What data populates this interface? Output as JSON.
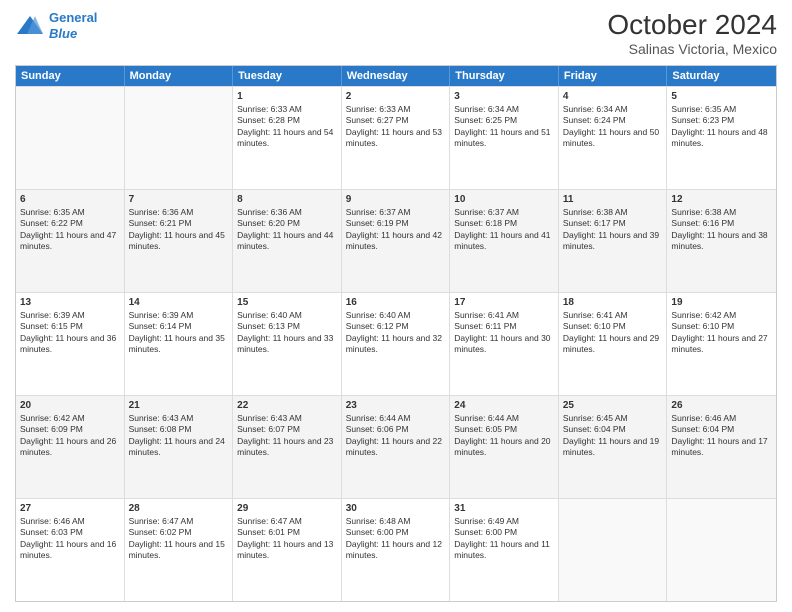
{
  "header": {
    "logo_line1": "General",
    "logo_line2": "Blue",
    "title": "October 2024",
    "subtitle": "Salinas Victoria, Mexico"
  },
  "weekdays": [
    "Sunday",
    "Monday",
    "Tuesday",
    "Wednesday",
    "Thursday",
    "Friday",
    "Saturday"
  ],
  "weeks": [
    {
      "alt": false,
      "days": [
        {
          "num": "",
          "info": ""
        },
        {
          "num": "",
          "info": ""
        },
        {
          "num": "1",
          "info": "Sunrise: 6:33 AM\nSunset: 6:28 PM\nDaylight: 11 hours and 54 minutes."
        },
        {
          "num": "2",
          "info": "Sunrise: 6:33 AM\nSunset: 6:27 PM\nDaylight: 11 hours and 53 minutes."
        },
        {
          "num": "3",
          "info": "Sunrise: 6:34 AM\nSunset: 6:25 PM\nDaylight: 11 hours and 51 minutes."
        },
        {
          "num": "4",
          "info": "Sunrise: 6:34 AM\nSunset: 6:24 PM\nDaylight: 11 hours and 50 minutes."
        },
        {
          "num": "5",
          "info": "Sunrise: 6:35 AM\nSunset: 6:23 PM\nDaylight: 11 hours and 48 minutes."
        }
      ]
    },
    {
      "alt": true,
      "days": [
        {
          "num": "6",
          "info": "Sunrise: 6:35 AM\nSunset: 6:22 PM\nDaylight: 11 hours and 47 minutes."
        },
        {
          "num": "7",
          "info": "Sunrise: 6:36 AM\nSunset: 6:21 PM\nDaylight: 11 hours and 45 minutes."
        },
        {
          "num": "8",
          "info": "Sunrise: 6:36 AM\nSunset: 6:20 PM\nDaylight: 11 hours and 44 minutes."
        },
        {
          "num": "9",
          "info": "Sunrise: 6:37 AM\nSunset: 6:19 PM\nDaylight: 11 hours and 42 minutes."
        },
        {
          "num": "10",
          "info": "Sunrise: 6:37 AM\nSunset: 6:18 PM\nDaylight: 11 hours and 41 minutes."
        },
        {
          "num": "11",
          "info": "Sunrise: 6:38 AM\nSunset: 6:17 PM\nDaylight: 11 hours and 39 minutes."
        },
        {
          "num": "12",
          "info": "Sunrise: 6:38 AM\nSunset: 6:16 PM\nDaylight: 11 hours and 38 minutes."
        }
      ]
    },
    {
      "alt": false,
      "days": [
        {
          "num": "13",
          "info": "Sunrise: 6:39 AM\nSunset: 6:15 PM\nDaylight: 11 hours and 36 minutes."
        },
        {
          "num": "14",
          "info": "Sunrise: 6:39 AM\nSunset: 6:14 PM\nDaylight: 11 hours and 35 minutes."
        },
        {
          "num": "15",
          "info": "Sunrise: 6:40 AM\nSunset: 6:13 PM\nDaylight: 11 hours and 33 minutes."
        },
        {
          "num": "16",
          "info": "Sunrise: 6:40 AM\nSunset: 6:12 PM\nDaylight: 11 hours and 32 minutes."
        },
        {
          "num": "17",
          "info": "Sunrise: 6:41 AM\nSunset: 6:11 PM\nDaylight: 11 hours and 30 minutes."
        },
        {
          "num": "18",
          "info": "Sunrise: 6:41 AM\nSunset: 6:10 PM\nDaylight: 11 hours and 29 minutes."
        },
        {
          "num": "19",
          "info": "Sunrise: 6:42 AM\nSunset: 6:10 PM\nDaylight: 11 hours and 27 minutes."
        }
      ]
    },
    {
      "alt": true,
      "days": [
        {
          "num": "20",
          "info": "Sunrise: 6:42 AM\nSunset: 6:09 PM\nDaylight: 11 hours and 26 minutes."
        },
        {
          "num": "21",
          "info": "Sunrise: 6:43 AM\nSunset: 6:08 PM\nDaylight: 11 hours and 24 minutes."
        },
        {
          "num": "22",
          "info": "Sunrise: 6:43 AM\nSunset: 6:07 PM\nDaylight: 11 hours and 23 minutes."
        },
        {
          "num": "23",
          "info": "Sunrise: 6:44 AM\nSunset: 6:06 PM\nDaylight: 11 hours and 22 minutes."
        },
        {
          "num": "24",
          "info": "Sunrise: 6:44 AM\nSunset: 6:05 PM\nDaylight: 11 hours and 20 minutes."
        },
        {
          "num": "25",
          "info": "Sunrise: 6:45 AM\nSunset: 6:04 PM\nDaylight: 11 hours and 19 minutes."
        },
        {
          "num": "26",
          "info": "Sunrise: 6:46 AM\nSunset: 6:04 PM\nDaylight: 11 hours and 17 minutes."
        }
      ]
    },
    {
      "alt": false,
      "days": [
        {
          "num": "27",
          "info": "Sunrise: 6:46 AM\nSunset: 6:03 PM\nDaylight: 11 hours and 16 minutes."
        },
        {
          "num": "28",
          "info": "Sunrise: 6:47 AM\nSunset: 6:02 PM\nDaylight: 11 hours and 15 minutes."
        },
        {
          "num": "29",
          "info": "Sunrise: 6:47 AM\nSunset: 6:01 PM\nDaylight: 11 hours and 13 minutes."
        },
        {
          "num": "30",
          "info": "Sunrise: 6:48 AM\nSunset: 6:00 PM\nDaylight: 11 hours and 12 minutes."
        },
        {
          "num": "31",
          "info": "Sunrise: 6:49 AM\nSunset: 6:00 PM\nDaylight: 11 hours and 11 minutes."
        },
        {
          "num": "",
          "info": ""
        },
        {
          "num": "",
          "info": ""
        }
      ]
    }
  ]
}
